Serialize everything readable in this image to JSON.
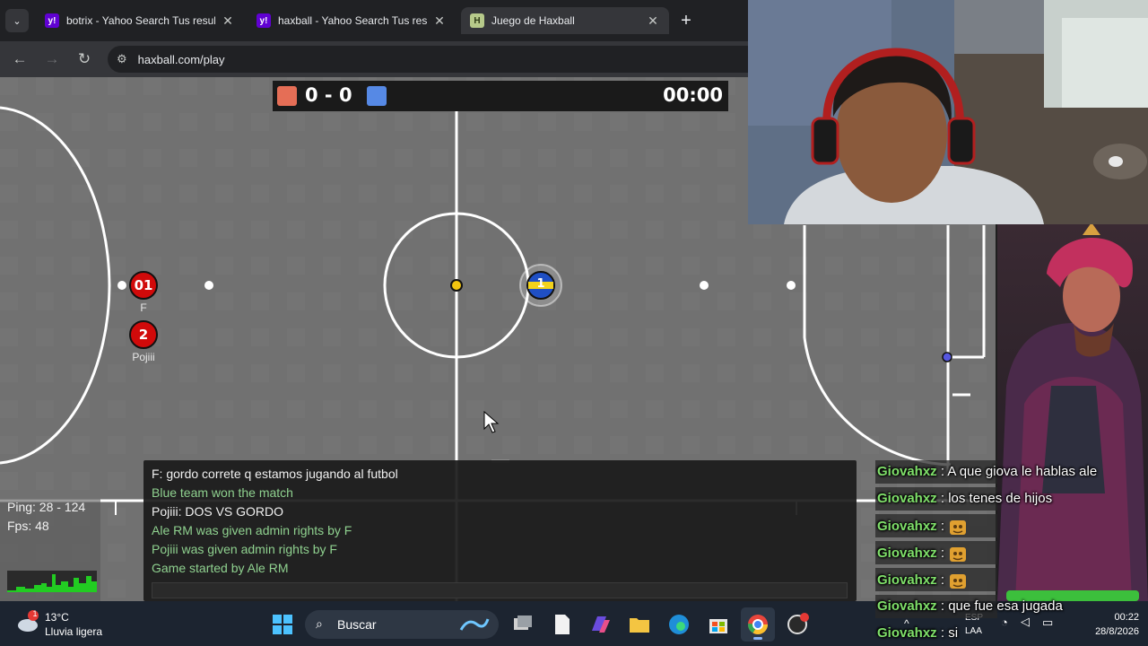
{
  "browser": {
    "tabs": [
      {
        "title": "botrix - Yahoo Search Tus result",
        "favicon": "yahoo-icon",
        "close": "✕"
      },
      {
        "title": "haxball - Yahoo Search Tus resu",
        "favicon": "yahoo-icon",
        "close": "✕"
      },
      {
        "title": "Juego de Haxball",
        "favicon": "haxball-icon",
        "close": "✕",
        "active": true
      }
    ],
    "new_tab": "+",
    "url": "haxball.com/play"
  },
  "game": {
    "score": "0 - 0",
    "timer": "00:00",
    "red_color": "#e56e56",
    "blue_color": "#5689e5",
    "players": [
      {
        "number": "01",
        "name": "F",
        "team": "red"
      },
      {
        "number": "2",
        "name": "Pojiii",
        "team": "red"
      },
      {
        "number": "1",
        "name": "",
        "team": "blue"
      }
    ],
    "stats": {
      "ping": "Ping: 28 - 124",
      "fps": "Fps: 48"
    }
  },
  "chat": {
    "lines": [
      {
        "text": "F: gordo correte q estamos jugando al futbol",
        "kind": "user"
      },
      {
        "text": "Blue team won the match",
        "kind": "system"
      },
      {
        "text": "Pojiii: DOS VS GORDO",
        "kind": "user"
      },
      {
        "text": "Ale RM was given admin rights by F",
        "kind": "system"
      },
      {
        "text": "Pojiii was given admin rights by F",
        "kind": "system"
      },
      {
        "text": "Game started by Ale RM",
        "kind": "system"
      }
    ],
    "input_value": ""
  },
  "stream_chat": {
    "lines": [
      {
        "name": "Giovahxz",
        "sep": " : ",
        "message": "A que giova le hablas ale"
      },
      {
        "name": "Giovahxz",
        "sep": " : ",
        "message": "los tenes de hijos"
      },
      {
        "name": "Giovahxz",
        "sep": " : ",
        "message": "",
        "emote": "emote-icon"
      },
      {
        "name": "Giovahxz",
        "sep": " : ",
        "message": "",
        "emote": "emote-icon"
      },
      {
        "name": "Giovahxz",
        "sep": " : ",
        "message": "",
        "emote": "emote-icon"
      },
      {
        "name": "Giovahxz",
        "sep": " : ",
        "message": "que fue esa jugada"
      },
      {
        "name": "Giovahxz",
        "sep": " : ",
        "message": "si"
      }
    ]
  },
  "taskbar": {
    "weather_badge": "1",
    "weather_temp": "13°C",
    "weather_desc": "Lluvia ligera",
    "search_label": "Buscar",
    "lang_top": "ESP",
    "lang_bottom": "LAA",
    "time": "00:22",
    "date": "28/8/2026"
  }
}
